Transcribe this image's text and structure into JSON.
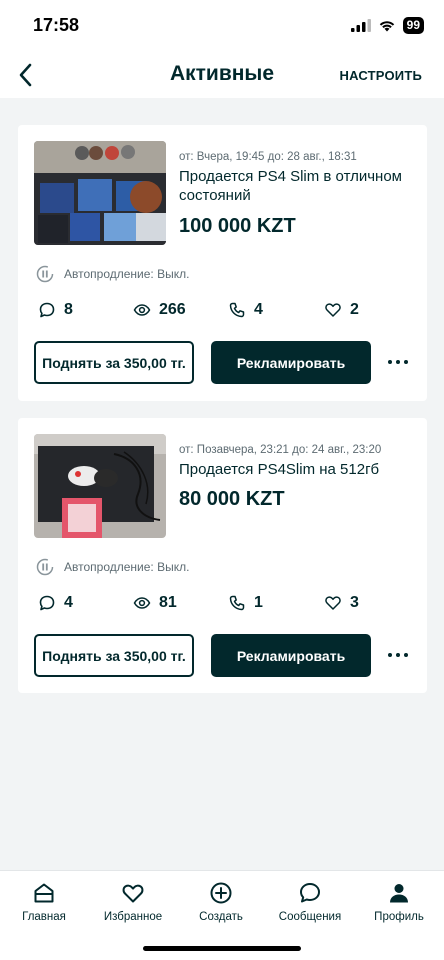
{
  "status_bar": {
    "time": "17:58",
    "battery": "99"
  },
  "nav": {
    "title": "Активные",
    "action": "НАСТРОИТЬ"
  },
  "listings": [
    {
      "meta": "от: Вчера, 19:45 до: 28 авг., 18:31",
      "title": "Продается PS4 Slim в отличном состояний",
      "price": "100 000 KZT",
      "renew": "Автопродление: Выкл.",
      "stats": {
        "messages": "8",
        "views": "266",
        "calls": "4",
        "favorites": "2"
      },
      "boost_label": "Поднять за 350,00 тг.",
      "advertise_label": "Рекламировать"
    },
    {
      "meta": "от: Позавчера, 23:21 до: 24 авг., 23:20",
      "title": "Продается PS4Slim на 512гб",
      "price": "80 000 KZT",
      "renew": "Автопродление: Выкл.",
      "stats": {
        "messages": "4",
        "views": "81",
        "calls": "1",
        "favorites": "3"
      },
      "boost_label": "Поднять за 350,00 тг.",
      "advertise_label": "Рекламировать"
    }
  ],
  "tabs": [
    {
      "label": "Главная",
      "icon": "home-icon"
    },
    {
      "label": "Избранное",
      "icon": "heart-icon"
    },
    {
      "label": "Создать",
      "icon": "plus-circle-icon"
    },
    {
      "label": "Сообщения",
      "icon": "chat-icon"
    },
    {
      "label": "Профиль",
      "icon": "person-icon"
    }
  ],
  "colors": {
    "primary": "#02282c",
    "background": "#f2f4f5",
    "muted": "#5d6b72"
  }
}
